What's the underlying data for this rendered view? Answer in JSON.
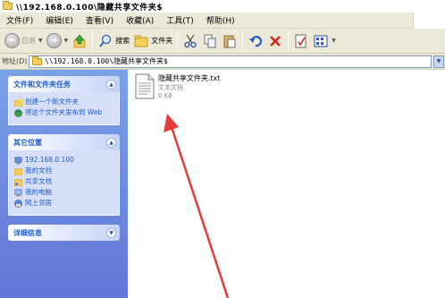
{
  "window": {
    "title": "\\\\192.168.0.100\\隐藏共享文件夹$"
  },
  "menu": [
    "文件(F)",
    "编辑(E)",
    "查看(V)",
    "收藏(A)",
    "工具(T)",
    "帮助(H)"
  ],
  "toolbar": {
    "back_label": "后退",
    "search_label": "搜索",
    "folders_label": "文件夹"
  },
  "address": {
    "label": "地址(D)",
    "value": "\\\\192.168.0.100\\隐藏共享文件夹$"
  },
  "sidebar": {
    "tasks": {
      "title": "文件和文件夹任务",
      "items": [
        "创建一个新文件夹",
        "将这个文件夹发布到 Web"
      ]
    },
    "places": {
      "title": "其它位置",
      "items": [
        "192.168.0.100",
        "我的文档",
        "共享文档",
        "我的电脑",
        "网上邻居"
      ]
    },
    "details": {
      "title": "详细信息"
    }
  },
  "file": {
    "name": "隐藏共享文件夹.txt",
    "type": "文本文档",
    "size": "0 KB"
  },
  "colors": {
    "sidebar_top": "#7ba2e7",
    "sidebar_bottom": "#6375d6",
    "link_blue": "#215dc6",
    "arrow_red": "#e83a3a"
  }
}
